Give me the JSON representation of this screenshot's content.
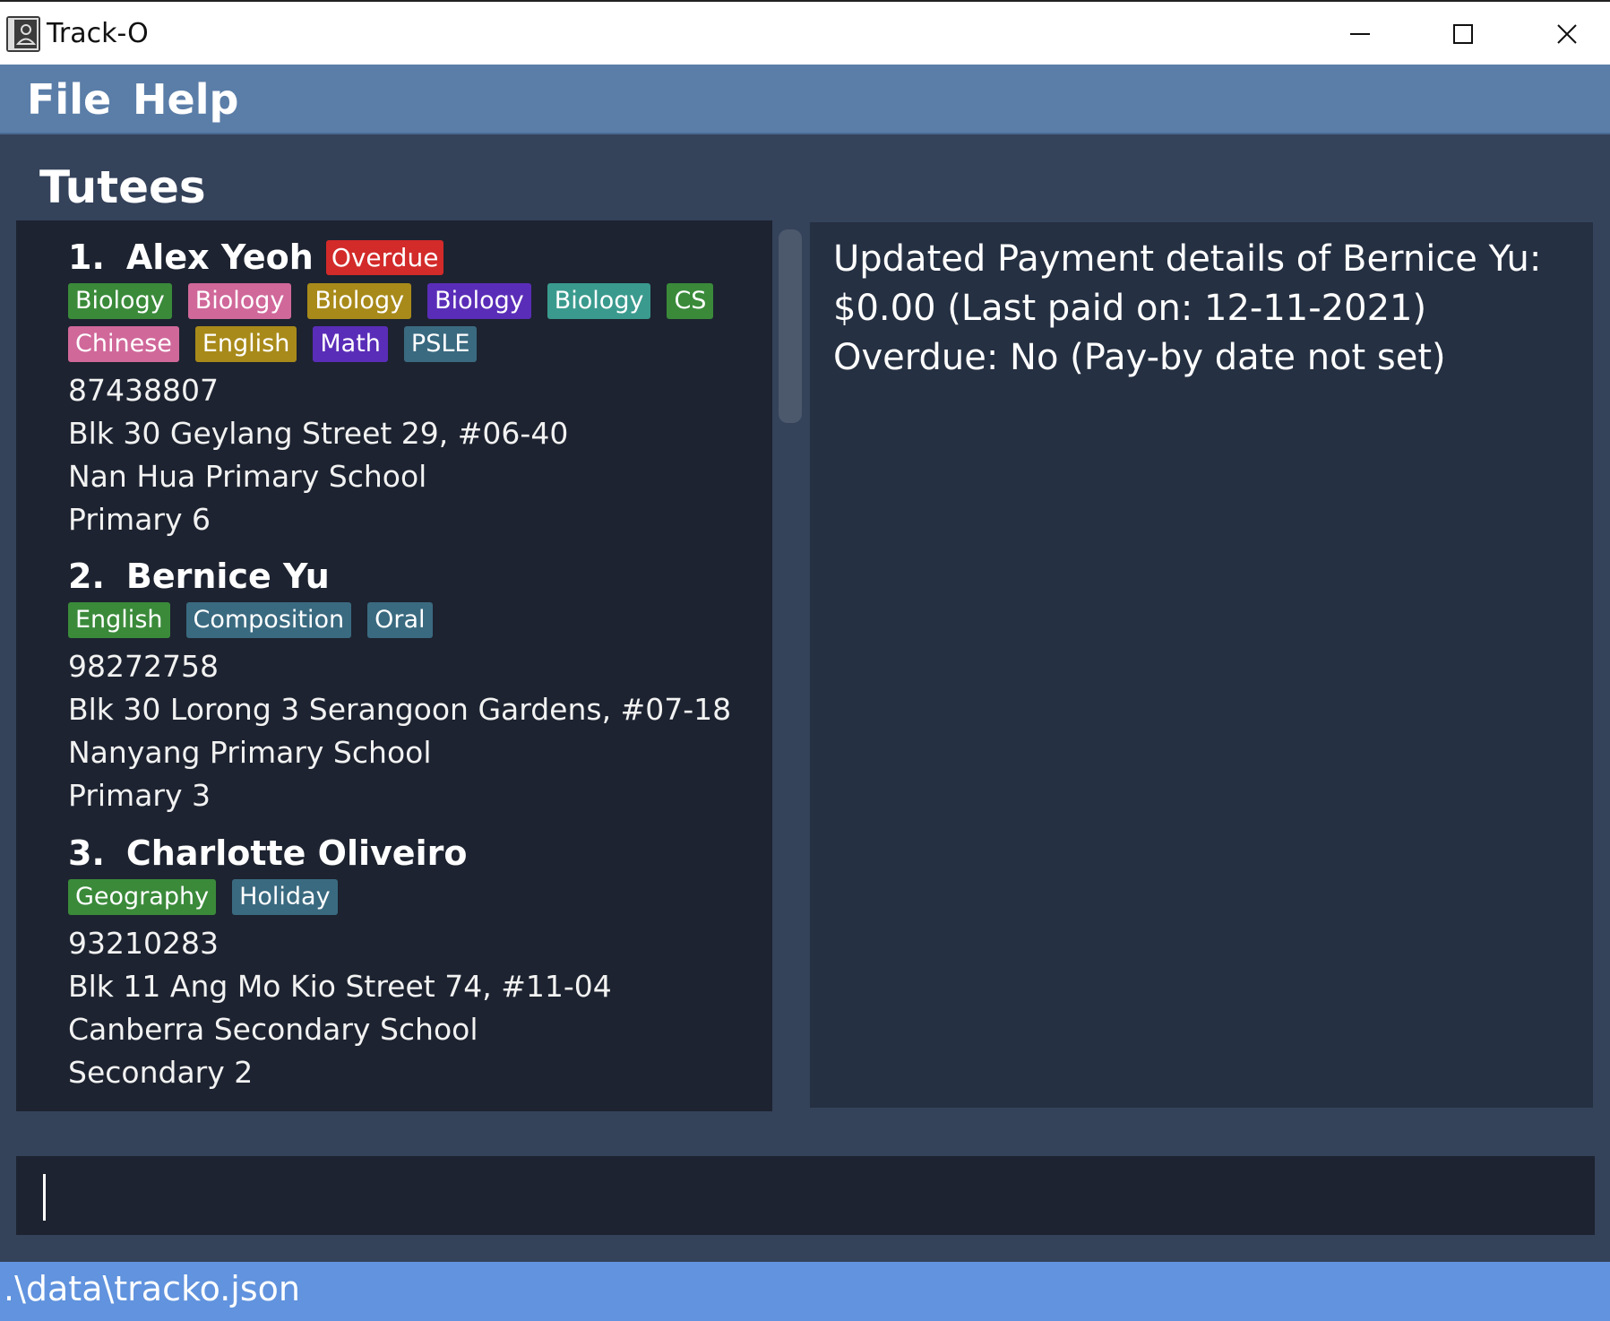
{
  "window": {
    "title": "Track-O",
    "icons": [
      "app-icon",
      "minimize-icon",
      "maximize-icon",
      "close-icon"
    ]
  },
  "menu": {
    "file": "File",
    "help": "Help"
  },
  "section_title": "Tutees",
  "tutees": [
    {
      "index": "1.",
      "name": "Alex Yeoh",
      "overdue_label": "Overdue",
      "tags": [
        {
          "label": "Biology",
          "color": "#3a8a3a"
        },
        {
          "label": "Biology",
          "color": "#d0689a"
        },
        {
          "label": "Biology",
          "color": "#a88a1a"
        },
        {
          "label": "Biology",
          "color": "#5a2db8"
        },
        {
          "label": "Biology",
          "color": "#3a9a8e"
        },
        {
          "label": "CS",
          "color": "#3a8a3a"
        },
        {
          "label": "Chinese",
          "color": "#d0689a"
        },
        {
          "label": "English",
          "color": "#a88a1a"
        },
        {
          "label": "Math",
          "color": "#5a2db8"
        },
        {
          "label": "PSLE",
          "color": "#3a6a80"
        }
      ],
      "phone": "87438807",
      "address": "Blk 30 Geylang Street 29, #06-40",
      "school": "Nan Hua Primary School",
      "level": "Primary 6"
    },
    {
      "index": "2.",
      "name": "Bernice Yu",
      "overdue_label": "",
      "tags": [
        {
          "label": "English",
          "color": "#3a8a3a"
        },
        {
          "label": "Composition",
          "color": "#3a6a80"
        },
        {
          "label": "Oral",
          "color": "#3a6a80"
        }
      ],
      "phone": "98272758",
      "address": "Blk 30 Lorong 3 Serangoon Gardens, #07-18",
      "school": "Nanyang Primary School",
      "level": "Primary 3"
    },
    {
      "index": "3.",
      "name": "Charlotte Oliveiro",
      "overdue_label": "",
      "tags": [
        {
          "label": "Geography",
          "color": "#3a8a3a"
        },
        {
          "label": "Holiday",
          "color": "#3a6a80"
        }
      ],
      "phone": "93210283",
      "address": "Blk 11 Ang Mo Kio Street 74, #11-04",
      "school": "Canberra Secondary School",
      "level": "Secondary 2"
    }
  ],
  "result": {
    "line1": "Updated Payment details of Bernice Yu:",
    "line2": "$0.00 (Last paid on: 12-11-2021)",
    "line3": "Overdue: No (Pay-by date not set)"
  },
  "command_input": {
    "value": ""
  },
  "status": {
    "path": ".\\data\\tracko.json"
  }
}
